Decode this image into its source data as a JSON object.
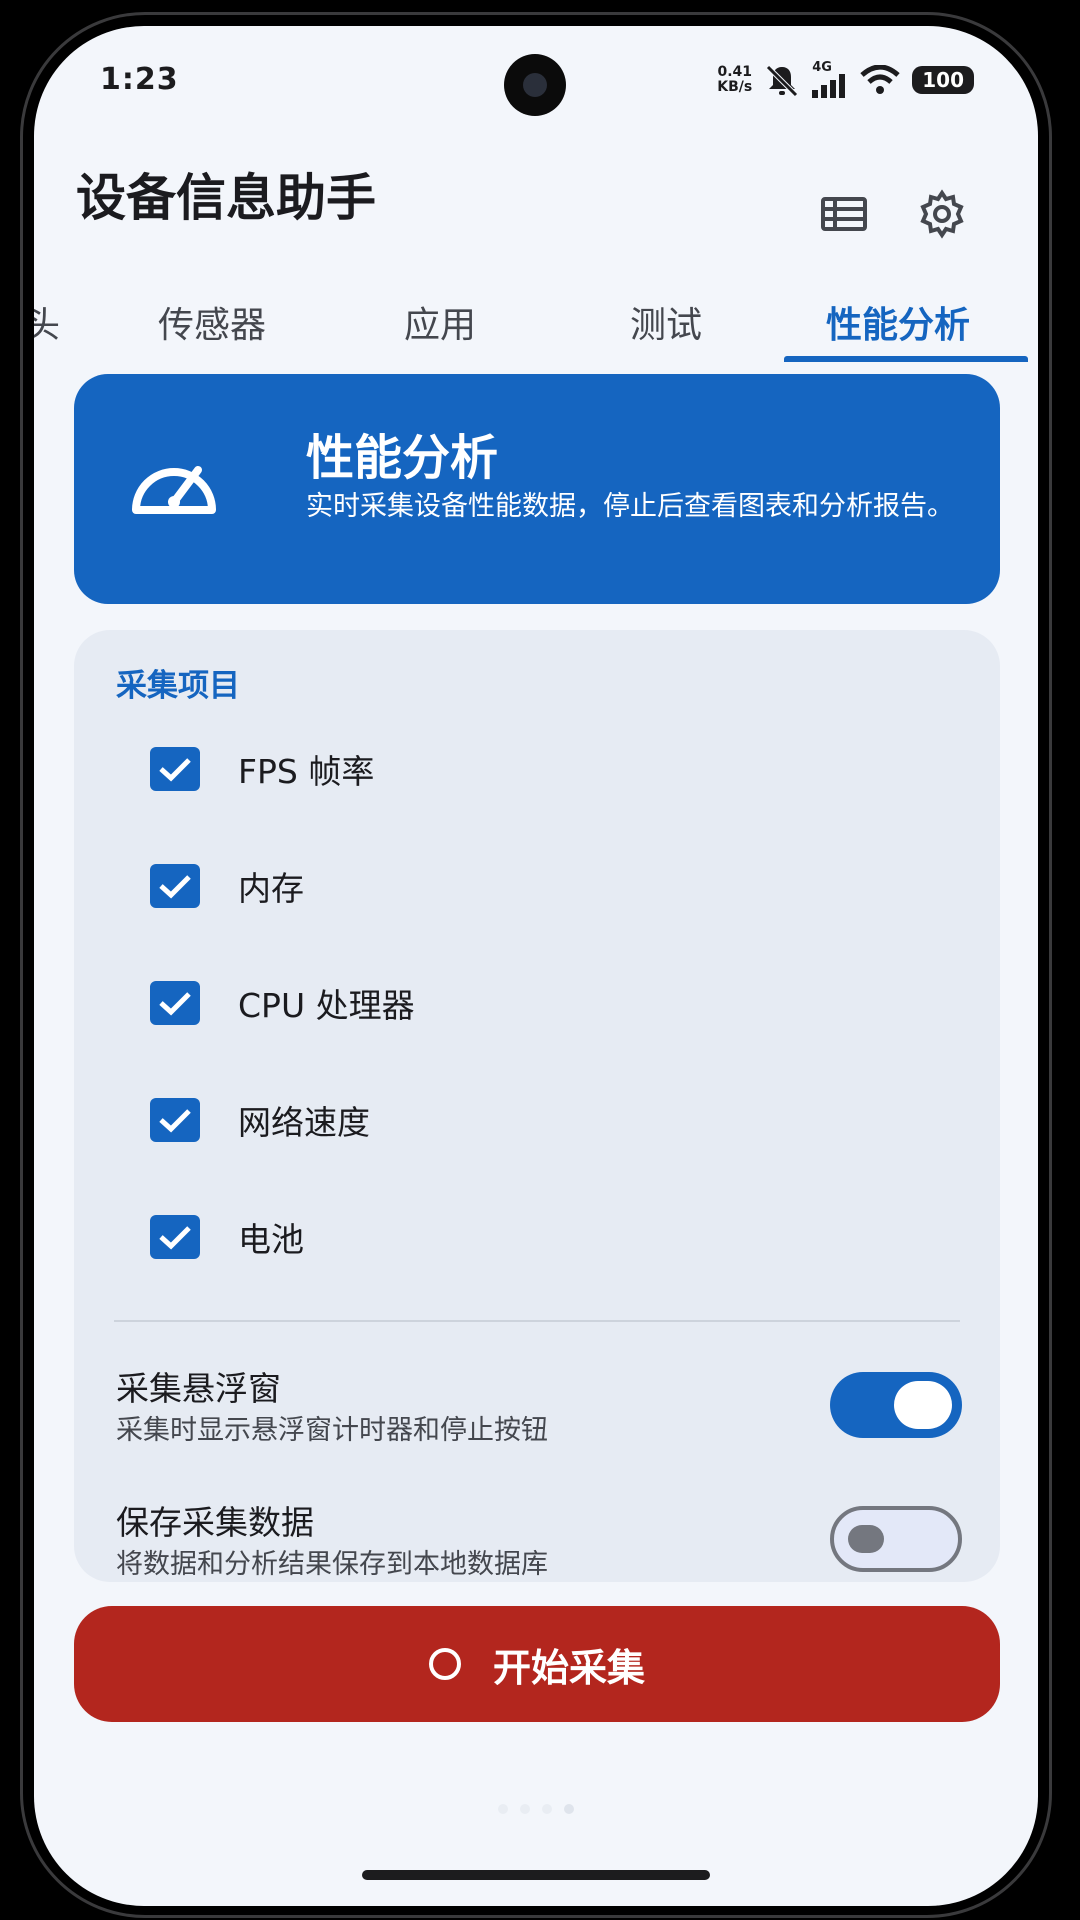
{
  "status_bar": {
    "time": "1:23",
    "net_speed_value": "0.41",
    "net_speed_unit": "KB/s",
    "network": "4G",
    "battery": "100"
  },
  "app_bar": {
    "title": "设备信息助手",
    "list_icon": "list-icon",
    "settings_icon": "gear-icon"
  },
  "tabs": [
    {
      "label": "头",
      "active": false
    },
    {
      "label": "传感器",
      "active": false
    },
    {
      "label": "应用",
      "active": false
    },
    {
      "label": "测试",
      "active": false
    },
    {
      "label": "性能分析",
      "active": true
    }
  ],
  "hero": {
    "icon": "speedometer-icon",
    "title": "性能分析",
    "description": "实时采集设备性能数据，停止后查看图表和分析报告。"
  },
  "collection": {
    "section_title": "采集项目",
    "items": [
      {
        "label": "FPS 帧率",
        "checked": true
      },
      {
        "label": "内存",
        "checked": true
      },
      {
        "label": "CPU 处理器",
        "checked": true
      },
      {
        "label": "网络速度",
        "checked": true
      },
      {
        "label": "电池",
        "checked": true
      }
    ],
    "toggles": [
      {
        "title": "采集悬浮窗",
        "subtitle": "采集时显示悬浮窗计时器和停止按钮",
        "on": true
      },
      {
        "title": "保存采集数据",
        "subtitle": "将数据和分析结果保存到本地数据库",
        "on": false
      }
    ]
  },
  "start_button": {
    "label": "开始采集"
  },
  "colors": {
    "primary": "#1565c0",
    "danger": "#b3261e",
    "background": "#f3f6fb",
    "card": "#e6ebf3"
  }
}
